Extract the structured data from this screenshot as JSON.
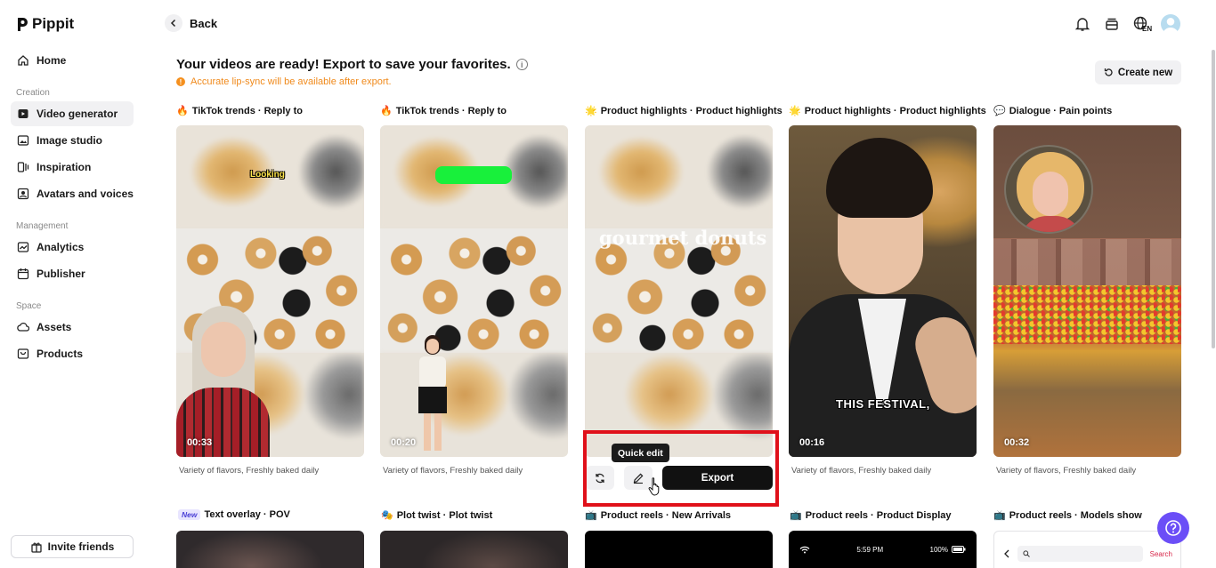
{
  "app": {
    "brand": "Pippit"
  },
  "sidebar": {
    "sections": {
      "creation": "Creation",
      "management": "Management",
      "space": "Space"
    },
    "items": [
      {
        "label": "Home",
        "icon": "home-icon"
      },
      {
        "label": "Video generator",
        "icon": "video-generator-icon",
        "active": true
      },
      {
        "label": "Image studio",
        "icon": "image-icon"
      },
      {
        "label": "Inspiration",
        "icon": "inspiration-icon"
      },
      {
        "label": "Avatars and voices",
        "icon": "avatar-icon"
      },
      {
        "label": "Analytics",
        "icon": "analytics-icon"
      },
      {
        "label": "Publisher",
        "icon": "calendar-icon"
      },
      {
        "label": "Assets",
        "icon": "cloud-icon"
      },
      {
        "label": "Products",
        "icon": "product-icon"
      }
    ],
    "invite_label": "Invite friends"
  },
  "topbar": {
    "back_label": "Back",
    "lang_code": "EN"
  },
  "header": {
    "headline": "Your videos are ready! Export to save your favorites.",
    "warning": "Accurate lip-sync will be available after export.",
    "create_new": "Create new"
  },
  "cards": [
    {
      "emoji": "🔥",
      "title": "TikTok trends · Reply to",
      "duration": "00:33",
      "desc": "Variety of flavors, Freshly baked daily",
      "overlay": "Looking"
    },
    {
      "emoji": "🔥",
      "title": "TikTok trends · Reply to",
      "duration": "00:20",
      "desc": "Variety of flavors, Freshly baked daily"
    },
    {
      "emoji": "🌟",
      "title": "Product highlights · Product highlights",
      "overlay": "gourmet donuts"
    },
    {
      "emoji": "🌟",
      "title": "Product highlights · Product highlights",
      "duration": "00:16",
      "desc": "Variety of flavors, Freshly baked daily",
      "overlay": "THIS FESTIVAL,"
    },
    {
      "emoji": "💬",
      "title": "Dialogue · Pain points",
      "duration": "00:32",
      "desc": "Variety of flavors, Freshly baked daily"
    }
  ],
  "actions": {
    "tooltip": "Quick edit",
    "export": "Export"
  },
  "row2": [
    {
      "badge": "New",
      "title": "Text overlay · POV"
    },
    {
      "emoji": "🎭",
      "title": "Plot twist · Plot twist"
    },
    {
      "emoji": "📺",
      "title": "Product reels · New Arrivals"
    },
    {
      "emoji": "📺",
      "title": "Product reels · Product Display",
      "status_time": "5:59 PM",
      "status_battery": "100%"
    },
    {
      "emoji": "📺",
      "title": "Product reels · Models show",
      "search_label": "Search"
    }
  ],
  "colors": {
    "accent": "#6b4ef7",
    "warning": "#f08a1c",
    "highlight": "#e0101a"
  }
}
